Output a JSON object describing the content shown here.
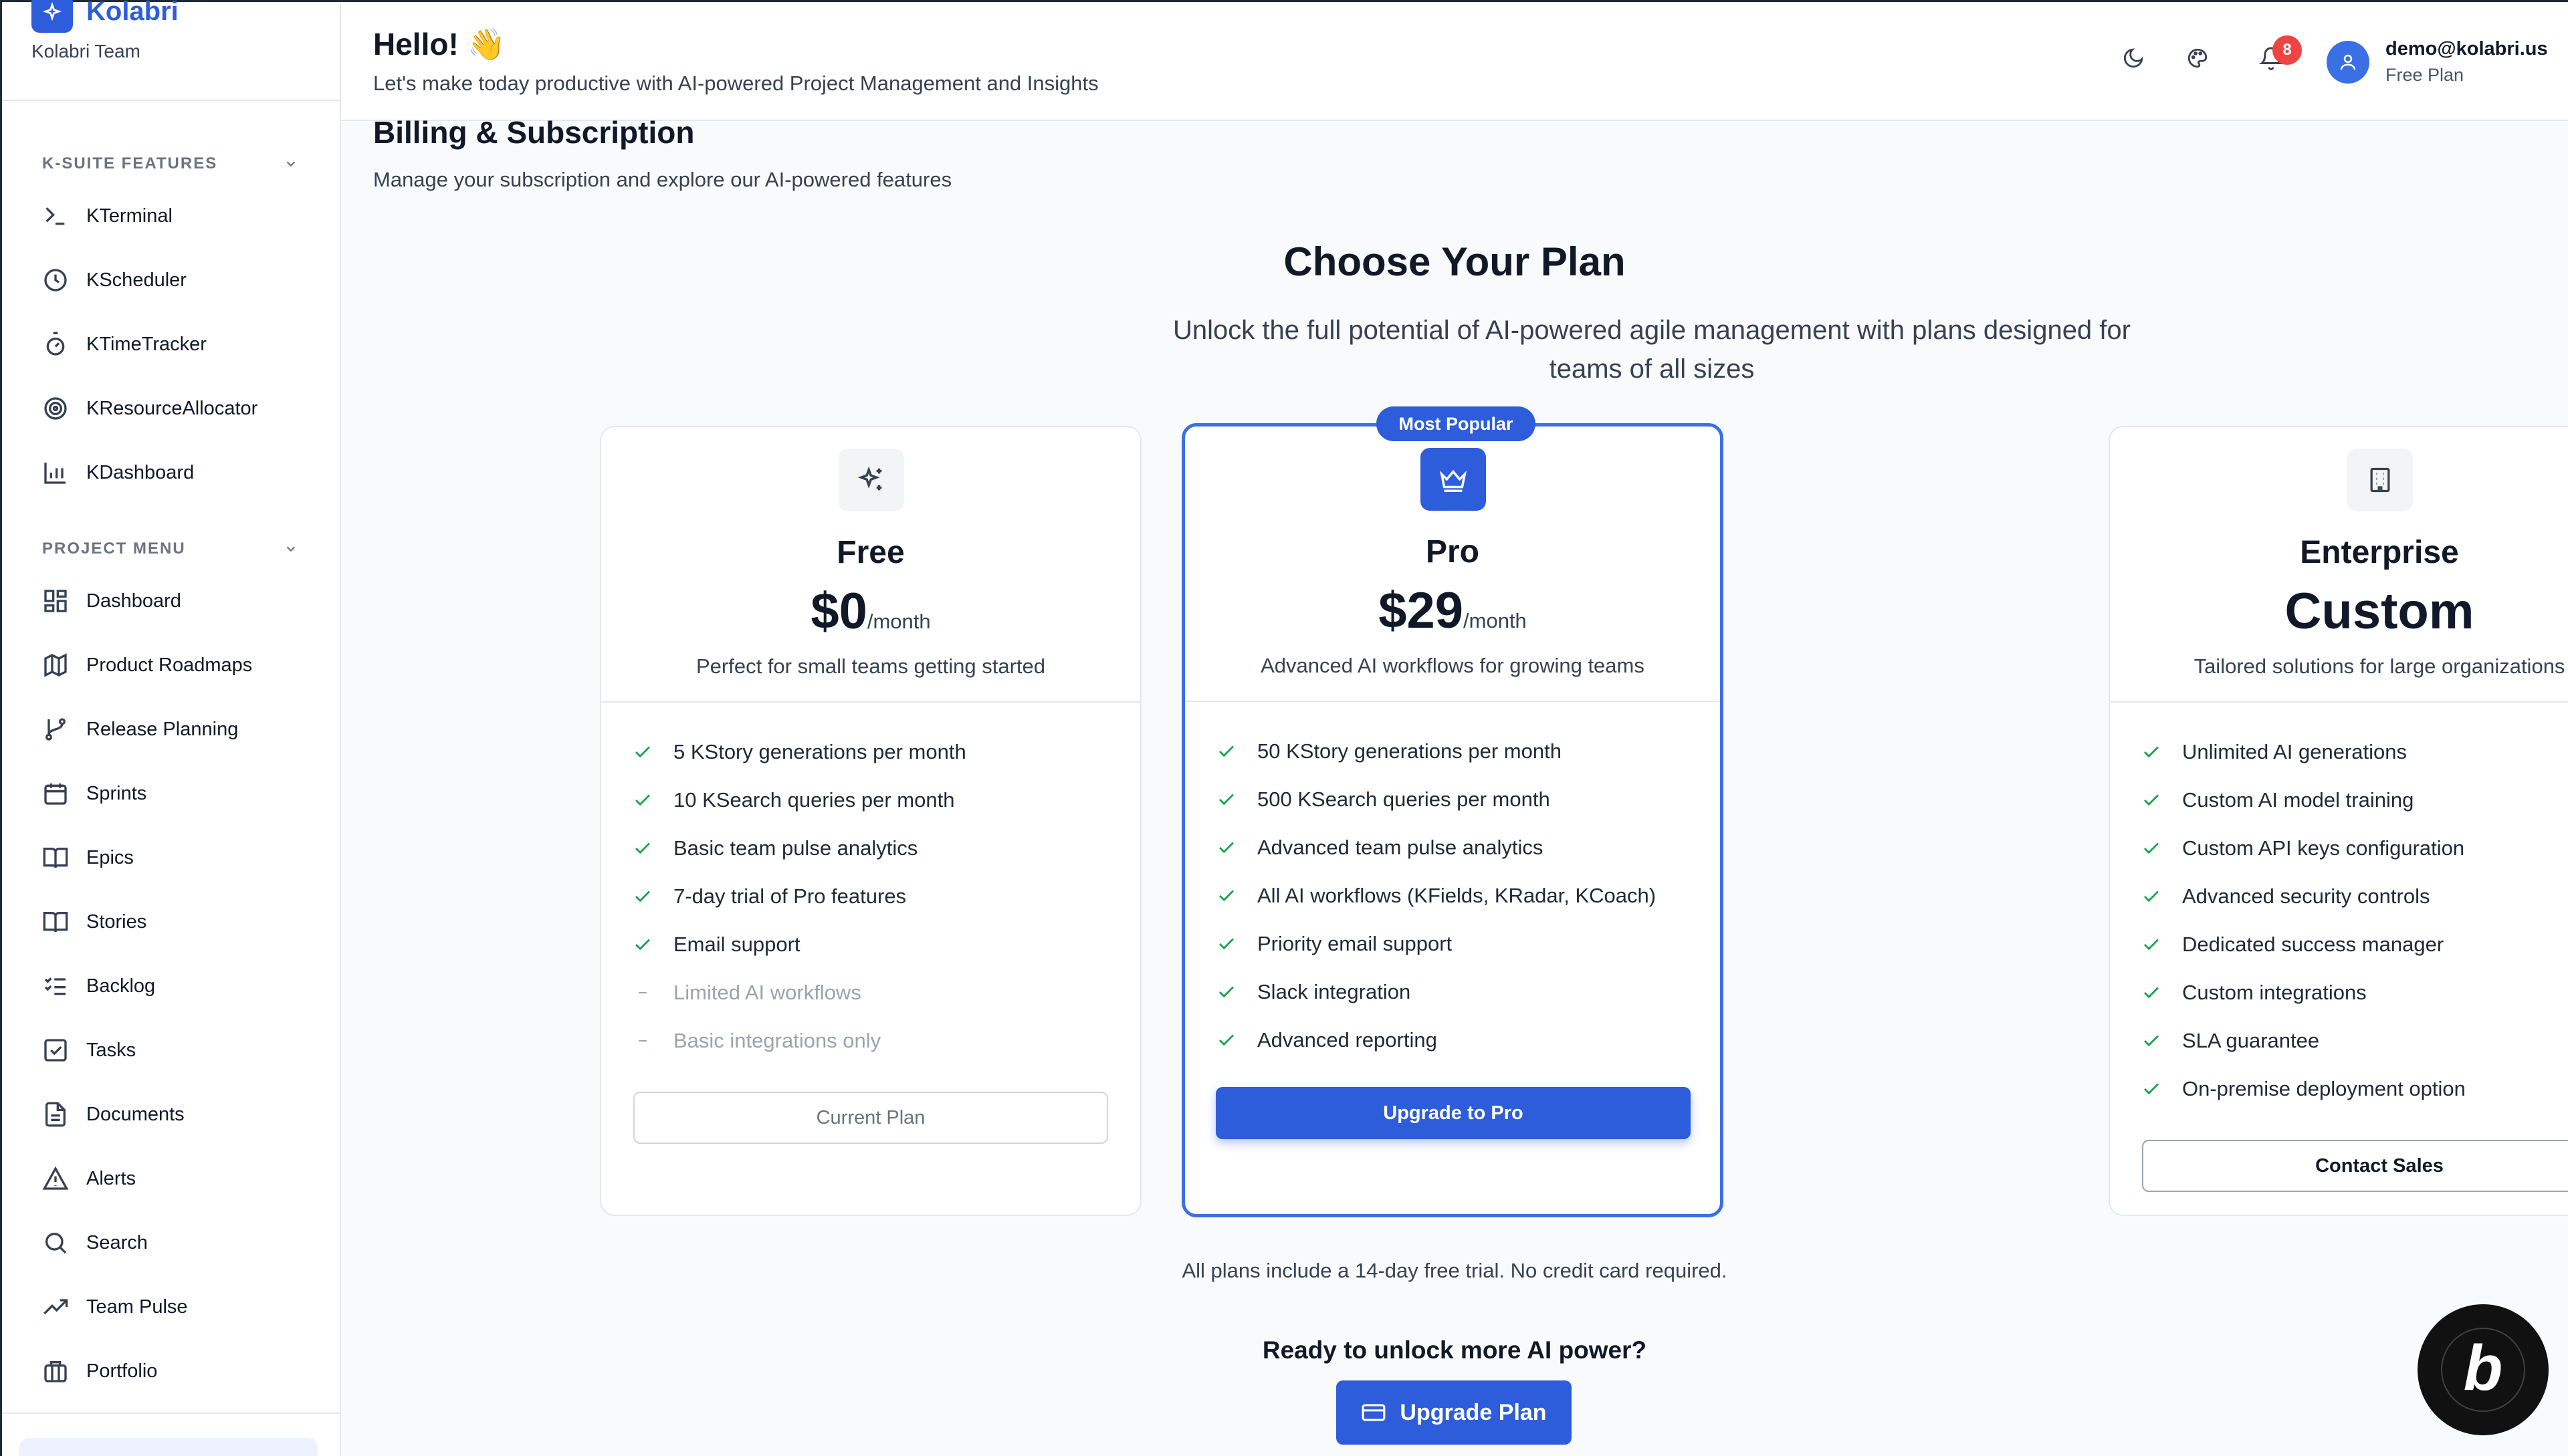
{
  "brand": {
    "name": "Kolabri",
    "team": "Kolabri Team"
  },
  "sidebar": {
    "ksuite": {
      "title": "K-SUITE FEATURES",
      "items": [
        {
          "label": "KTerminal",
          "icon": "terminal-icon"
        },
        {
          "label": "KScheduler",
          "icon": "clock-icon"
        },
        {
          "label": "KTimeTracker",
          "icon": "timer-icon"
        },
        {
          "label": "KResourceAllocator",
          "icon": "target-icon"
        },
        {
          "label": "KDashboard",
          "icon": "bar-chart-icon"
        }
      ]
    },
    "project": {
      "title": "PROJECT MENU",
      "items": [
        {
          "label": "Dashboard",
          "icon": "grid-icon"
        },
        {
          "label": "Product Roadmaps",
          "icon": "map-icon"
        },
        {
          "label": "Release Planning",
          "icon": "git-branch-icon"
        },
        {
          "label": "Sprints",
          "icon": "calendar-icon"
        },
        {
          "label": "Epics",
          "icon": "book-open-icon"
        },
        {
          "label": "Stories",
          "icon": "book-icon"
        },
        {
          "label": "Backlog",
          "icon": "list-checks-icon"
        },
        {
          "label": "Tasks",
          "icon": "check-square-icon"
        },
        {
          "label": "Documents",
          "icon": "file-text-icon"
        },
        {
          "label": "Alerts",
          "icon": "alert-triangle-icon"
        },
        {
          "label": "Search",
          "icon": "search-icon"
        },
        {
          "label": "Team Pulse",
          "icon": "trending-up-icon"
        },
        {
          "label": "Portfolio",
          "icon": "briefcase-icon"
        }
      ]
    }
  },
  "header": {
    "greeting": "Hello! 👋",
    "subtitle": "Let's make today productive with AI-powered Project Management and Insights",
    "notifications_count": "8",
    "user_email": "demo@kolabri.us",
    "user_plan": "Free Plan"
  },
  "page": {
    "title": "Billing & Subscription",
    "subtitle": "Manage your subscription and explore our AI-powered features",
    "choose_title": "Choose Your Plan",
    "choose_subtitle": "Unlock the full potential of AI-powered agile management with plans designed for teams of all sizes",
    "note": "All plans include a 14-day free trial. No credit card required.",
    "cta_heading": "Ready to unlock more AI power?",
    "cta_button": "Upgrade Plan"
  },
  "plans": {
    "free": {
      "name": "Free",
      "price": "$0",
      "unit": "/month",
      "desc": "Perfect for small teams getting started",
      "features": [
        "5 KStory generations per month",
        "10 KSearch queries per month",
        "Basic team pulse analytics",
        "7-day trial of Pro features",
        "Email support"
      ],
      "limits": [
        "Limited AI workflows",
        "Basic integrations only"
      ],
      "button": "Current Plan"
    },
    "pro": {
      "badge": "Most Popular",
      "name": "Pro",
      "price": "$29",
      "unit": "/month",
      "desc": "Advanced AI workflows for growing teams",
      "features": [
        "50 KStory generations per month",
        "500 KSearch queries per month",
        "Advanced team pulse analytics",
        "All AI workflows (KFields, KRadar, KCoach)",
        "Priority email support",
        "Slack integration",
        "Advanced reporting"
      ],
      "button": "Upgrade to Pro"
    },
    "enterprise": {
      "name": "Enterprise",
      "price": "Custom",
      "desc": "Tailored solutions for large organizations",
      "features": [
        "Unlimited AI generations",
        "Custom AI model training",
        "Custom API keys configuration",
        "Advanced security controls",
        "Dedicated success manager",
        "Custom integrations",
        "SLA guarantee",
        "On-premise deployment option"
      ],
      "button": "Contact Sales"
    }
  },
  "colors": {
    "accent": "#2d5ddb",
    "check": "#16a34a",
    "badge": "#ef4444"
  }
}
